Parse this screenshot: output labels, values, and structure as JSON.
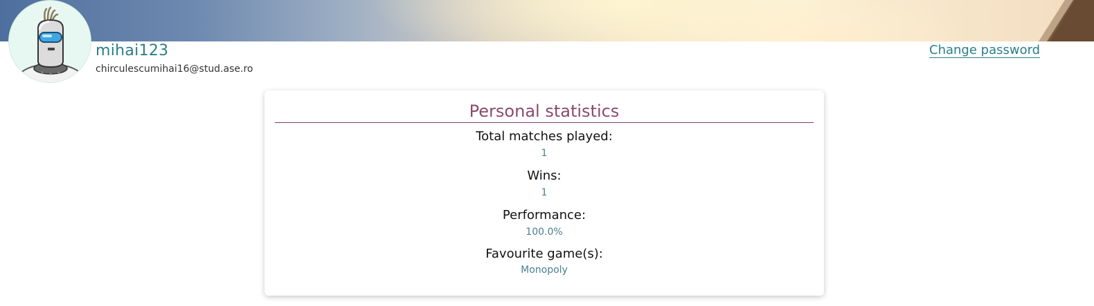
{
  "profile": {
    "username": "mihai123",
    "email": "chirculescumihai16@stud.ase.ro",
    "change_password_label": "Change password"
  },
  "stats": {
    "title": "Personal statistics",
    "items": [
      {
        "label": "Total matches played:",
        "value": "1"
      },
      {
        "label": "Wins:",
        "value": "1"
      },
      {
        "label": "Performance:",
        "value": "100.0%"
      },
      {
        "label": "Favourite game(s):",
        "value": "Monopoly"
      }
    ]
  },
  "colors": {
    "accent": "#2a7f87",
    "title": "#8a4a6e",
    "value": "#4a7e8f"
  }
}
